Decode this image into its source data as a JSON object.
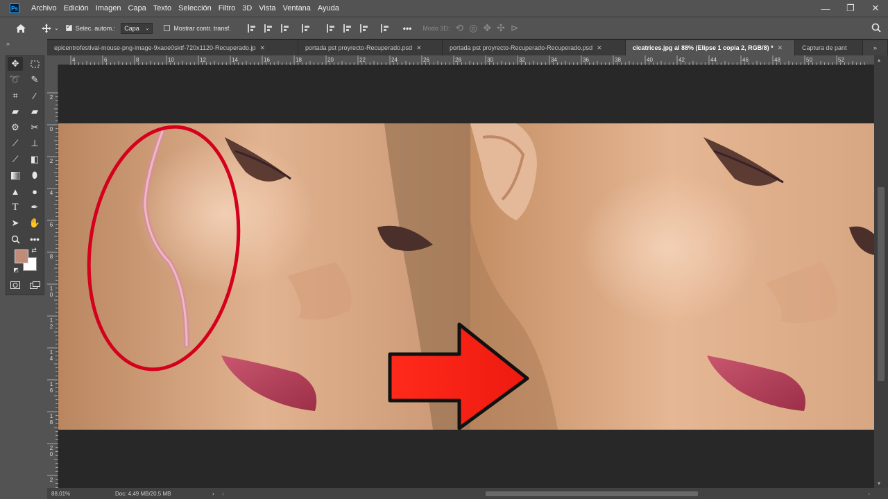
{
  "app": {
    "logo_text": "Ps"
  },
  "menubar": {
    "items": [
      "Archivo",
      "Edición",
      "Imagen",
      "Capa",
      "Texto",
      "Selección",
      "Filtro",
      "3D",
      "Vista",
      "Ventana",
      "Ayuda"
    ],
    "window_controls": {
      "minimize": "—",
      "restore": "❐",
      "close": "✕"
    }
  },
  "options_bar": {
    "auto_select_label": "Selec. autom.:",
    "auto_select_checked": true,
    "layer_select_value": "Capa",
    "show_transform_label": "Mostrar contr. transf.",
    "show_transform_checked": false,
    "more_label": "•••",
    "mode_3d_label": "Modo 3D:"
  },
  "tabs": [
    {
      "label": "epicentrofestival-mouse-png-image-9xaoe0sktf-720x1120-Recuperado.jp",
      "active": false,
      "close": "✕"
    },
    {
      "label": "portada pst proyrecto-Recuperado.psd",
      "active": false,
      "close": "✕"
    },
    {
      "label": "portada pst proyrecto-Recuperado-Recuperado.psd",
      "active": false,
      "close": "✕"
    },
    {
      "label": "cicatrices.jpg al 88% (Elipse 1 copia 2, RGB/8) *",
      "active": true,
      "close": "✕"
    },
    {
      "label": "Captura de pant",
      "active": false,
      "close": ""
    }
  ],
  "tab_overflow": "»",
  "panel_collapse": "»",
  "ruler_h": {
    "labels": [
      "4",
      "6",
      "8",
      "10",
      "12",
      "14",
      "16",
      "18",
      "20",
      "22",
      "24",
      "26",
      "28",
      "30",
      "32",
      "34",
      "36",
      "38",
      "40",
      "42",
      "44",
      "46",
      "48",
      "50",
      "52"
    ]
  },
  "ruler_v": {
    "labels": [
      {
        "lines": [
          "2"
        ]
      },
      {
        "lines": [
          "0"
        ]
      },
      {
        "lines": [
          "2"
        ]
      },
      {
        "lines": [
          "4"
        ]
      },
      {
        "lines": [
          "6"
        ]
      },
      {
        "lines": [
          "8"
        ]
      },
      {
        "lines": [
          "1",
          "0"
        ]
      },
      {
        "lines": [
          "1",
          "2"
        ]
      },
      {
        "lines": [
          "1",
          "4"
        ]
      },
      {
        "lines": [
          "1",
          "6"
        ]
      },
      {
        "lines": [
          "1",
          "8"
        ]
      },
      {
        "lines": [
          "2",
          "0"
        ]
      },
      {
        "lines": [
          "2"
        ]
      }
    ]
  },
  "colors": {
    "foreground": "#c08c7a",
    "background": "#ffffff",
    "ellipse_stroke": "#d4001c",
    "arrow_fill": "#ff1a10"
  },
  "statusbar": {
    "zoom": "88,01%",
    "doc_info": "Doc: 4,49 MB/20,5 MB",
    "more_arrow": "›",
    "scroll_left": "‹",
    "scroll_right": "›"
  },
  "scroll_icons": {
    "up": "▴",
    "down": "▾"
  }
}
